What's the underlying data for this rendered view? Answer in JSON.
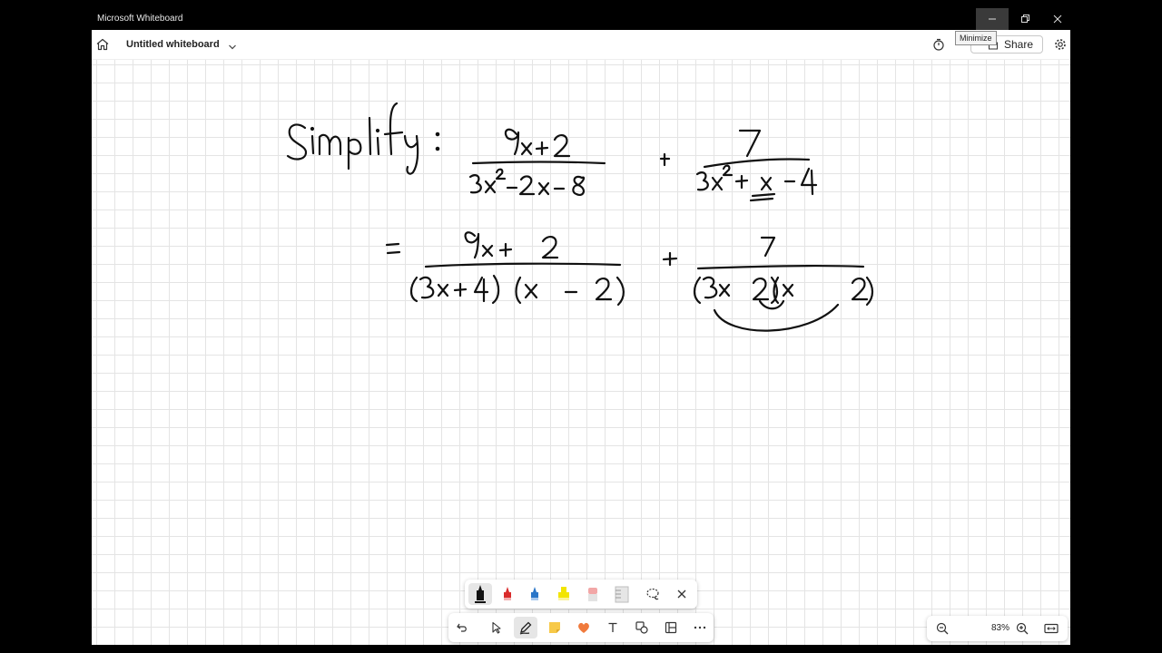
{
  "window": {
    "app_title": "Microsoft Whiteboard",
    "tooltip": "Minimize"
  },
  "header": {
    "board_title": "Untitled whiteboard",
    "share_label": "Share"
  },
  "zoom": {
    "level": "83%"
  },
  "colors": {
    "titlebar": "#000000",
    "grid_line": "#e4e4e4",
    "ink": "#111111",
    "pen_red": "#d92b2b",
    "pen_blue": "#2a76c8",
    "highlighter_yellow": "#f2e500",
    "sticky_note": "#f7c948",
    "reaction_heart": "#f07a3c"
  },
  "icons": {
    "window": [
      "minimize-icon",
      "restore-icon",
      "close-icon"
    ],
    "header": [
      "home-icon",
      "chevron-down-icon",
      "timer-icon",
      "share-icon",
      "gear-icon"
    ],
    "pen_tray": [
      "black-pen-icon",
      "red-pen-icon",
      "blue-pen-icon",
      "yellow-highlighter-icon",
      "eraser-icon",
      "ruler-icon",
      "lasso-icon",
      "close-icon"
    ],
    "main_toolbar": [
      "undo-icon",
      "select-icon",
      "pen-icon",
      "sticky-note-icon",
      "reaction-icon",
      "text-icon",
      "shapes-icon",
      "template-icon",
      "more-icon"
    ],
    "zoom_bar": [
      "zoom-out-icon",
      "zoom-in-icon",
      "fit-to-screen-icon"
    ]
  }
}
